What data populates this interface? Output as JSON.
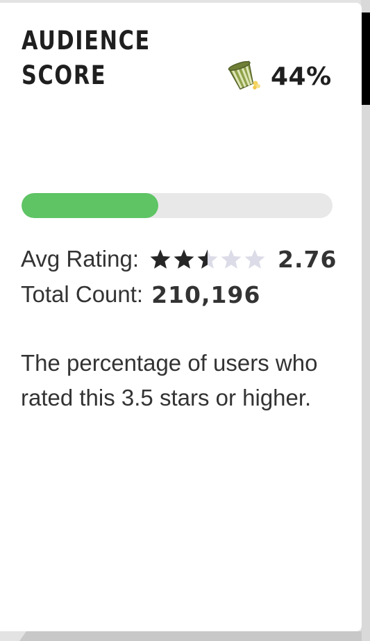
{
  "audience_score": {
    "title_lines": [
      "AUDIENCE",
      "SCORE"
    ],
    "score_text": "44%",
    "score_fraction": 0.44,
    "icon": "spilled-popcorn-bucket-icon",
    "colors": {
      "progress_fill": "#5ec464",
      "progress_track": "#e8e8e8",
      "star_filled": "#262626",
      "star_empty": "#dcdce8"
    }
  },
  "avg_rating": {
    "label": "Avg Rating:",
    "value": "2.76",
    "stars_filled": 2.76,
    "stars_total": 5
  },
  "total_count": {
    "label": "Total Count:",
    "value": "210,196"
  },
  "description": "The percentage of users who rated this 3.5 stars or higher."
}
